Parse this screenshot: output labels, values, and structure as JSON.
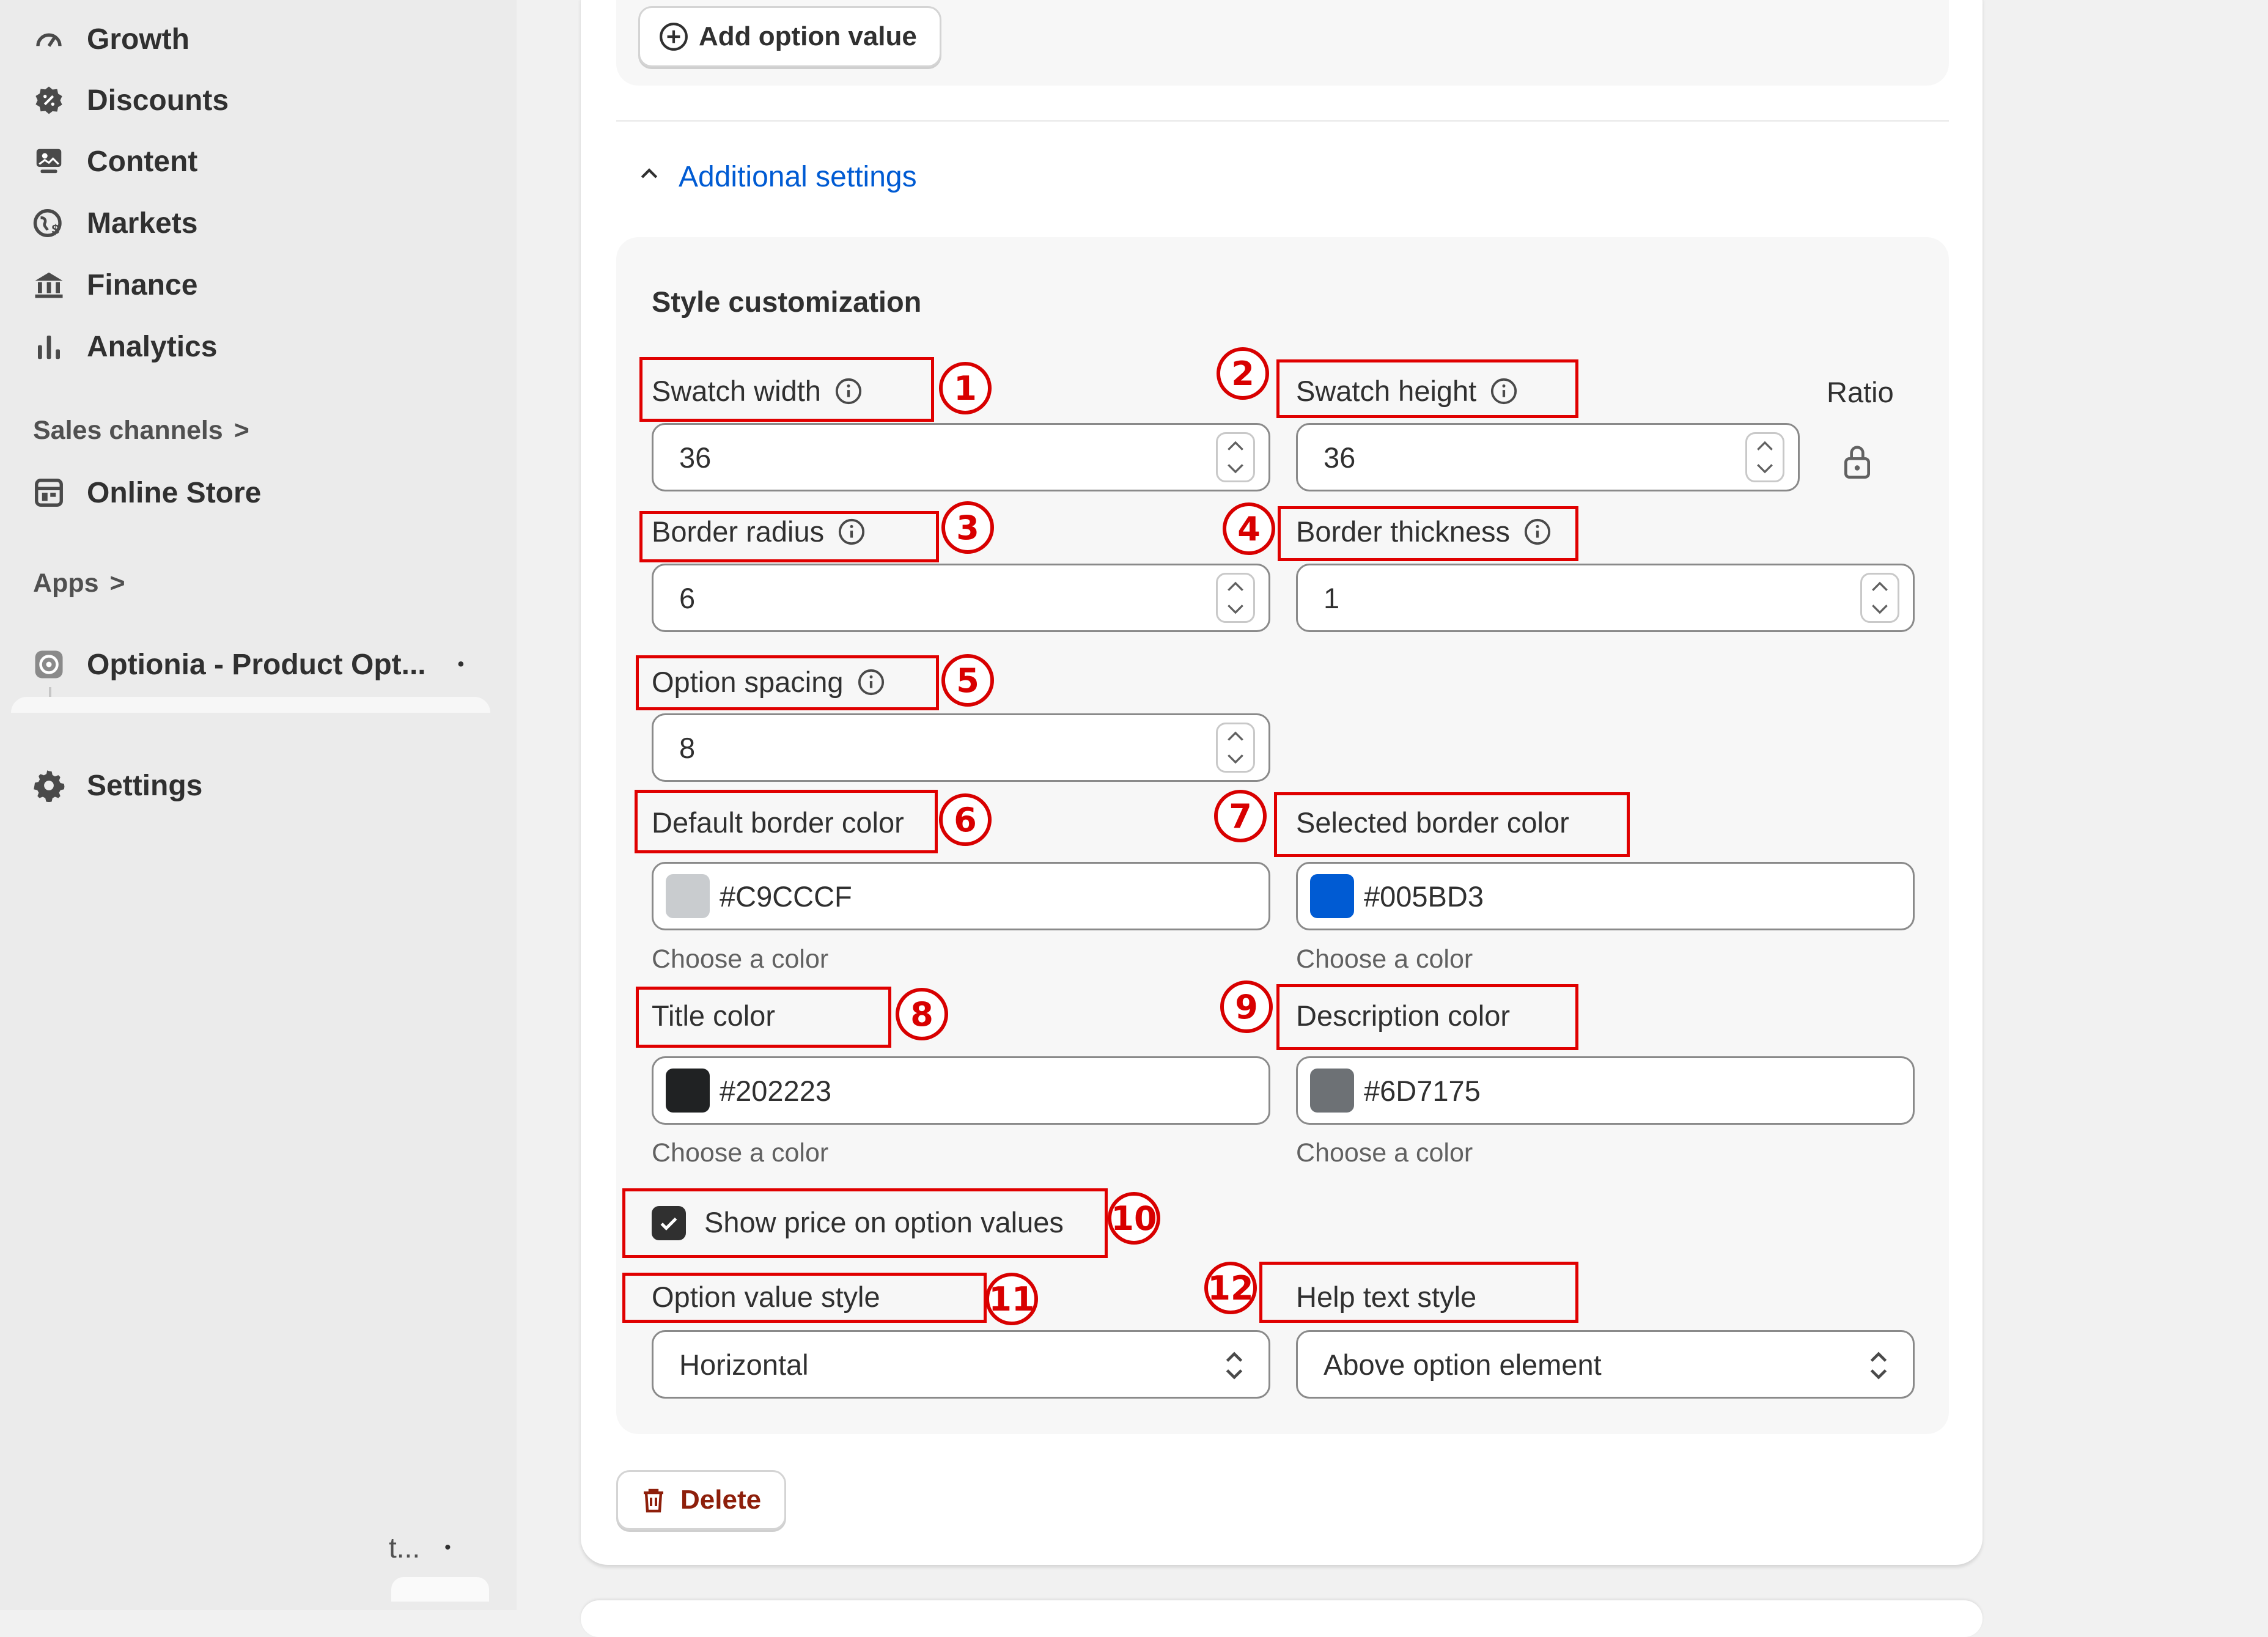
{
  "sidebar": {
    "items": [
      {
        "label": "Growth",
        "icon": "growth-icon"
      },
      {
        "label": "Discounts",
        "icon": "discount-icon"
      },
      {
        "label": "Content",
        "icon": "content-icon"
      },
      {
        "label": "Markets",
        "icon": "globe-icon"
      },
      {
        "label": "Finance",
        "icon": "bank-icon"
      },
      {
        "label": "Analytics",
        "icon": "bar-chart-icon"
      }
    ],
    "sales_channels": {
      "label": "Sales channels",
      "arrow": ">"
    },
    "online_store": {
      "label": "Online Store",
      "icon": "store-icon"
    },
    "apps": {
      "label": "Apps",
      "arrow": ">"
    },
    "app_item": {
      "label": "Optionia - Product Opt...",
      "dot": "•"
    },
    "settings": {
      "label": "Settings",
      "icon": "gear-icon"
    },
    "bottom_item": {
      "label": "t...",
      "dot": "•"
    }
  },
  "main": {
    "add_option_value": "Add option value",
    "additional_settings": "Additional settings",
    "style_title": "Style customization",
    "ratio_label": "Ratio",
    "fields": {
      "swatch_width": {
        "label": "Swatch width",
        "value": "36"
      },
      "swatch_height": {
        "label": "Swatch height",
        "value": "36"
      },
      "border_radius": {
        "label": "Border radius",
        "value": "6"
      },
      "border_thickness": {
        "label": "Border thickness",
        "value": "1"
      },
      "option_spacing": {
        "label": "Option spacing",
        "value": "8"
      }
    },
    "colors": {
      "default_border": {
        "label": "Default border color",
        "value": "#C9CCCF",
        "help": "Choose a color",
        "swatch": "#c9cccf"
      },
      "selected_border": {
        "label": "Selected border color",
        "value": "#005BD3",
        "help": "Choose a color",
        "swatch": "#005bd3"
      },
      "title": {
        "label": "Title color",
        "value": "#202223",
        "help": "Choose a color",
        "swatch": "#202223"
      },
      "description": {
        "label": "Description color",
        "value": "#6D7175",
        "help": "Choose a color",
        "swatch": "#6d7175"
      }
    },
    "show_price": {
      "label": "Show price on option values",
      "checked": true
    },
    "option_value_style": {
      "label": "Option value style",
      "selected": "Horizontal"
    },
    "help_text_style": {
      "label": "Help text style",
      "selected": "Above option element"
    },
    "delete": "Delete"
  },
  "annotations": [
    "1",
    "2",
    "3",
    "4",
    "5",
    "6",
    "7",
    "8",
    "9",
    "10",
    "11",
    "12"
  ],
  "theme": {
    "accent": "#005bd3",
    "annotation": "#e00000",
    "danger": "#8e1f0b"
  }
}
